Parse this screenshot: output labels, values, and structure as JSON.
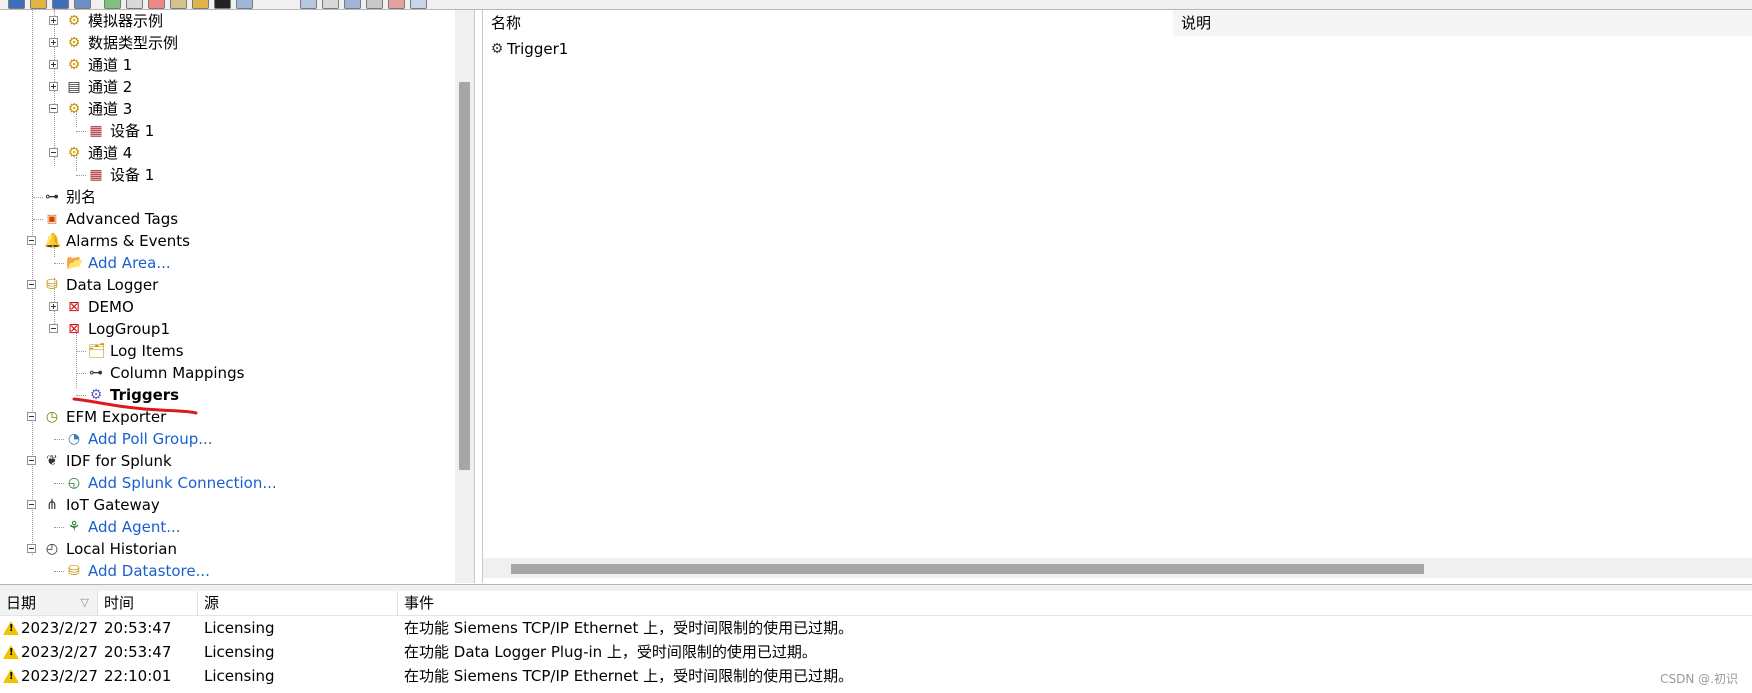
{
  "tree": {
    "items": [
      {
        "label": "模拟器示例",
        "icon": "gear-icon"
      },
      {
        "label": "数据类型示例",
        "icon": "gear-icon"
      },
      {
        "label": "通道 1",
        "icon": "gear-icon"
      },
      {
        "label": "通道 2",
        "icon": "channel-icon"
      },
      {
        "label": "通道 3",
        "icon": "gear-icon"
      },
      {
        "label": "设备 1",
        "icon": "device-icon"
      },
      {
        "label": "通道 4",
        "icon": "gear-icon"
      },
      {
        "label": "设备 1",
        "icon": "device-icon"
      },
      {
        "label": "别名",
        "icon": "alias-icon"
      },
      {
        "label": "Advanced Tags",
        "icon": "advanced-tags-icon"
      },
      {
        "label": "Alarms & Events",
        "icon": "alarm-bell-icon"
      },
      {
        "label": "Add Area...",
        "icon": "add-area-icon"
      },
      {
        "label": "Data Logger",
        "icon": "database-icon"
      },
      {
        "label": "DEMO",
        "icon": "log-group-error-icon"
      },
      {
        "label": "LogGroup1",
        "icon": "log-group-error-icon"
      },
      {
        "label": "Log Items",
        "icon": "log-items-icon"
      },
      {
        "label": "Column Mappings",
        "icon": "column-mappings-icon"
      },
      {
        "label": "Triggers",
        "icon": "triggers-icon"
      },
      {
        "label": "EFM Exporter",
        "icon": "efm-icon"
      },
      {
        "label": "Add Poll Group...",
        "icon": "add-poll-group-icon"
      },
      {
        "label": "IDF for Splunk",
        "icon": "splunk-icon"
      },
      {
        "label": "Add Splunk Connection...",
        "icon": "add-connection-icon"
      },
      {
        "label": "IoT Gateway",
        "icon": "iot-gateway-icon"
      },
      {
        "label": "Add Agent...",
        "icon": "add-agent-icon"
      },
      {
        "label": "Local Historian",
        "icon": "historian-icon"
      },
      {
        "label": "Add Datastore...",
        "icon": "add-datastore-icon"
      }
    ]
  },
  "list": {
    "columns": [
      "名称",
      "说明"
    ],
    "rows": [
      {
        "name": "Trigger1",
        "icon": "trigger-gear-icon",
        "description": ""
      }
    ]
  },
  "log": {
    "columns": [
      "日期",
      "时间",
      "源",
      "事件"
    ],
    "rows": [
      {
        "date": "2023/2/27",
        "time": "20:53:47",
        "source": "Licensing",
        "event": "在功能 Siemens TCP/IP Ethernet 上，受时间限制的使用已过期。",
        "icon": "warning-icon"
      },
      {
        "date": "2023/2/27",
        "time": "20:53:47",
        "source": "Licensing",
        "event": "在功能 Data Logger Plug-in 上，受时间限制的使用已过期。",
        "icon": "warning-icon"
      },
      {
        "date": "2023/2/27",
        "time": "22:10:01",
        "source": "Licensing",
        "event": "在功能 Siemens TCP/IP Ethernet 上，受时间限制的使用已过期。",
        "icon": "warning-icon"
      }
    ]
  },
  "watermark": "CSDN @.初识",
  "colors": {
    "link": "#1a5fd0",
    "annotation": "#e0191b",
    "warning": "#f2c300"
  }
}
